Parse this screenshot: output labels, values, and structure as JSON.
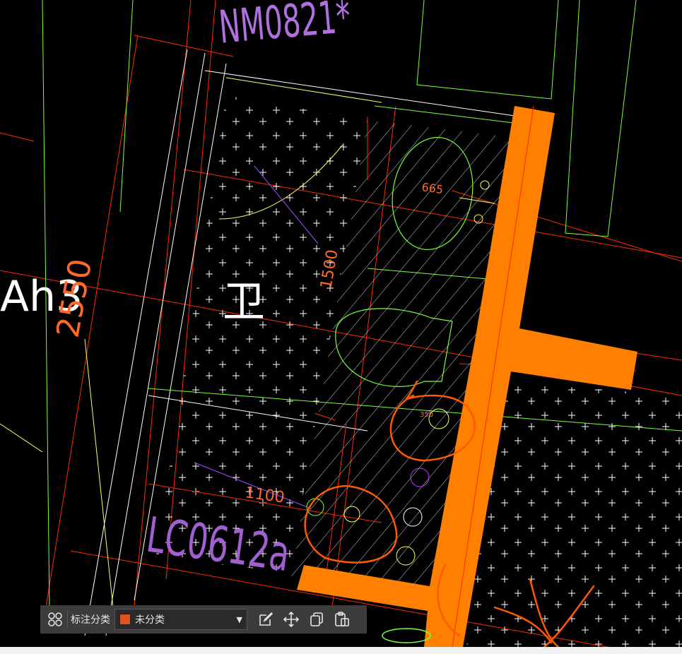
{
  "drawing": {
    "labels": {
      "window_tag": "NM0821*",
      "room_label": "Ah3",
      "dim_2550": "2550",
      "dim_1500": "1500",
      "dim_665": "665",
      "dim_350": "350",
      "dim_1100": "1100",
      "door_tag": "LC0612a",
      "room_char": "卫"
    },
    "colors": {
      "background": "#000000",
      "wall_fill": "#ff8000",
      "cad_white": "#ffffff",
      "cad_red": "#ff2a00",
      "cad_green": "#7cff3a",
      "cad_yellow": "#ffff66",
      "cad_purple": "#9b4dff",
      "markup_orange": "#ff5a00"
    }
  },
  "toolbar": {
    "grid_icon": "grid-four-icon",
    "category_label": "标注分类",
    "category_select": {
      "value": "未分类",
      "swatch_color": "#e0531f"
    },
    "buttons": [
      {
        "name": "edit-annotation-button",
        "icon": "edit-pencil-icon"
      },
      {
        "name": "move-button",
        "icon": "move-arrows-icon"
      },
      {
        "name": "copy-button",
        "icon": "copy-icon"
      },
      {
        "name": "paste-button",
        "icon": "paste-icon"
      }
    ]
  }
}
